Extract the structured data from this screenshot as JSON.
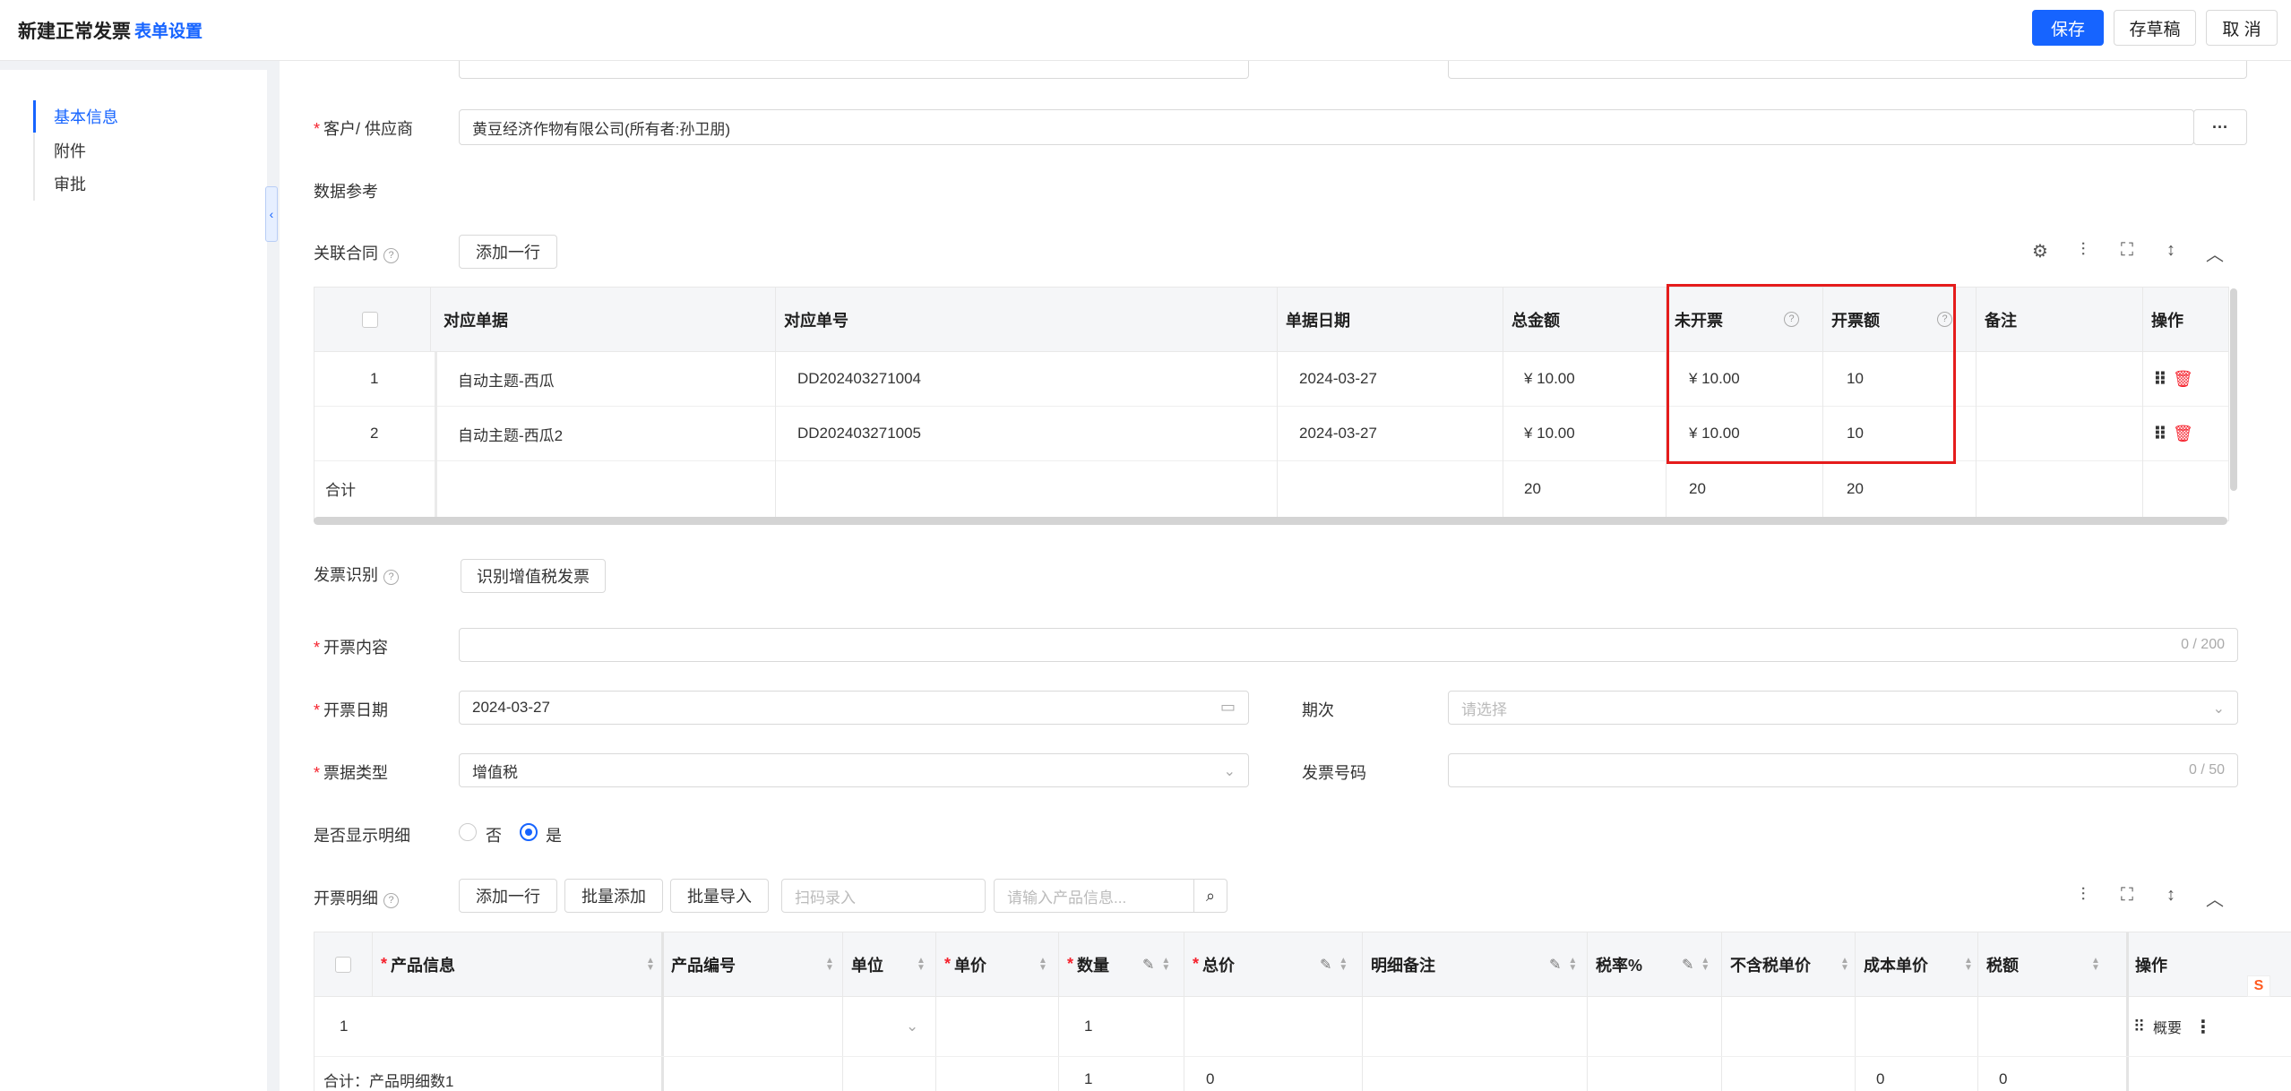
{
  "header": {
    "title": "新建正常发票",
    "form_settings": "表单设置",
    "save": "保存",
    "draft": "存草稿",
    "cancel": "取 消"
  },
  "nav": {
    "items": [
      {
        "label": "基本信息",
        "active": true
      },
      {
        "label": "附件",
        "active": false
      },
      {
        "label": "审批",
        "active": false
      }
    ]
  },
  "form": {
    "customer_label": "客户/ 供应商",
    "customer_value": "黄豆经济作物有限公司(所有者:孙卫朋)",
    "data_ref_label": "数据参考",
    "related_contract_label": "关联合同",
    "add_row": "添加一行",
    "invoice_recognition_label": "发票识别",
    "recognize_vat": "识别增值税发票",
    "content_label": "开票内容",
    "content_counter": "0 / 200",
    "date_label": "开票日期",
    "date_value": "2024-03-27",
    "period_label": "期次",
    "period_placeholder": "请选择",
    "type_label": "票据类型",
    "type_value": "增值税",
    "number_label": "发票号码",
    "number_counter": "0 / 50",
    "show_detail_label": "是否显示明细",
    "option_no": "否",
    "option_yes": "是",
    "detail_label": "开票明细",
    "batch_add": "批量添加",
    "batch_import": "批量导入",
    "scan_placeholder": "扫码录入",
    "product_search_placeholder": "请输入产品信息..."
  },
  "contract_table": {
    "headers": {
      "doc": "对应单据",
      "number": "对应单号",
      "date": "单据日期",
      "total": "总金额",
      "uninvoiced": "未开票",
      "invoiced": "开票额",
      "remark": "备注",
      "action": "操作"
    },
    "rows": [
      {
        "idx": "1",
        "doc": "自动主题-西瓜",
        "number": "DD202403271004",
        "date": "2024-03-27",
        "total": "¥ 10.00",
        "uninvoiced": "¥ 10.00",
        "invoiced": "10"
      },
      {
        "idx": "2",
        "doc": "自动主题-西瓜2",
        "number": "DD202403271005",
        "date": "2024-03-27",
        "total": "¥ 10.00",
        "uninvoiced": "¥ 10.00",
        "invoiced": "10"
      }
    ],
    "summary": {
      "label": "合计",
      "total": "20",
      "uninvoiced": "20",
      "invoiced": "20"
    }
  },
  "detail_table": {
    "headers": {
      "product": "产品信息",
      "code": "产品编号",
      "unit": "单位",
      "price": "单价",
      "qty": "数量",
      "amount": "总价",
      "remark": "明细备注",
      "tax_rate": "税率%",
      "price_ex_tax": "不含税单价",
      "cost": "成本单价",
      "tax": "税额",
      "action": "操作"
    },
    "row": {
      "idx": "1",
      "qty": "1",
      "detail_link": "概要"
    },
    "summary": {
      "label": "合计：产品明细数1",
      "qty": "1",
      "amount": "0",
      "cost": "0",
      "tax": "0"
    }
  },
  "colors": {
    "primary": "#1664ff",
    "highlight_box": "#e51c1c",
    "required": "#f5222d"
  }
}
